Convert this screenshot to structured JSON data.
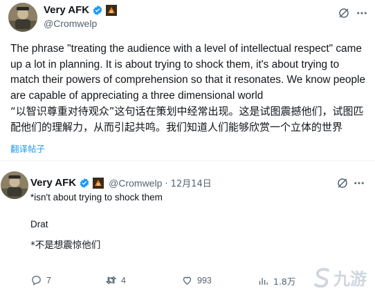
{
  "main_tweet": {
    "display_name": "Very AFK",
    "handle": "@Cromwelp",
    "text_en": "The phrase \"treating the audience with a level of intellectual respect\" came up a lot in planning. It is about trying to shock them, it's about trying to match their powers of comprehension so that it resonates. We know people are capable of appreciating a three dimensional world",
    "text_zh": "“以智识尊重对待观众”这句话在策划中经常出现。这是试图震撼他们，试图匹配他们的理解力，从而引起共鸣。我们知道人们能够欣赏一个立体的世界",
    "translate_label": "翻译帖子"
  },
  "reply_tweet": {
    "display_name": "Very AFK",
    "handle": "@Cromwelp",
    "date": "· 12月14日",
    "line1": "*isn't about trying to shock them",
    "line2": "Drat",
    "line3": "*不是想震惊他们",
    "actions": {
      "replies": "7",
      "reposts": "4",
      "likes": "993",
      "views": "1.8万"
    }
  },
  "watermark": "九游",
  "colors": {
    "verified": "#1d9bf0",
    "muted": "#536471",
    "link": "#1d9bf0"
  }
}
